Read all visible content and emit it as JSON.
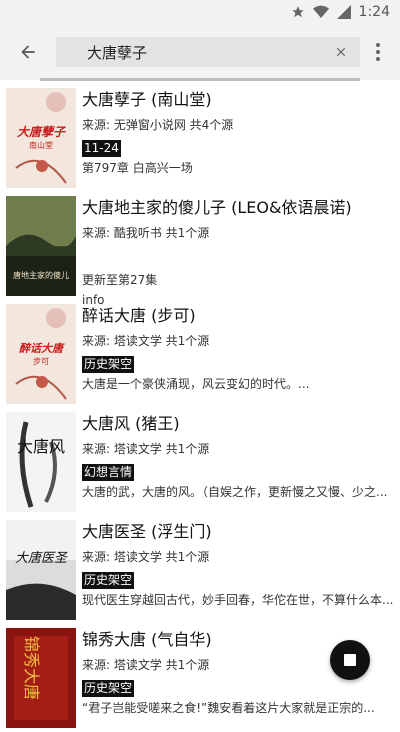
{
  "status": {
    "time": "1:24"
  },
  "search": {
    "query": "大唐孽子"
  },
  "results": [
    {
      "title": "大唐孽子 (南山堂)",
      "source": "来源:   无弹窗小说网  共4个源",
      "tag": "11-24",
      "line": "第797章 白高兴一场",
      "cover_title": "大唐孽子",
      "cover_sub": "南山堂"
    },
    {
      "title": "大唐地主家的傻儿子 (LEO&依语晨诺)",
      "source": "来源: 酷我听书  共1个源",
      "line": "更新至第27集",
      "extra": "info",
      "cover_title": "唐地主家的傻儿"
    },
    {
      "title": "醉话大唐 (步可)",
      "source": "来源: 塔读文学  共1个源",
      "tag": "历史架空",
      "line": "大唐是一个豪侠涌现，风云变幻的时代。...",
      "cover_title": "醉话大唐",
      "cover_sub": "步可"
    },
    {
      "title": "大唐风 (猪王)",
      "source": "来源: 塔读文学  共1个源",
      "tag": "幻想言情",
      "line": "大唐的武，大唐的风。（自娱之作，更新慢之又慢、少之...",
      "cover_title": "大唐风"
    },
    {
      "title": "大唐医圣 (浮生门)",
      "source": "来源: 塔读文学  共1个源",
      "tag": "历史架空",
      "line": "现代医生穿越回古代，妙手回春，华佗在世，不算什么本...",
      "cover_title": "大唐医圣"
    },
    {
      "title": "锦秀大唐 (气自华)",
      "source": "来源: 塔读文学  共1个源",
      "tag": "历史架空",
      "line": "“君子岂能受嗟来之食!”魏安看着这片大家就是正宗的...",
      "cover_title": "锦秀大唐"
    }
  ]
}
